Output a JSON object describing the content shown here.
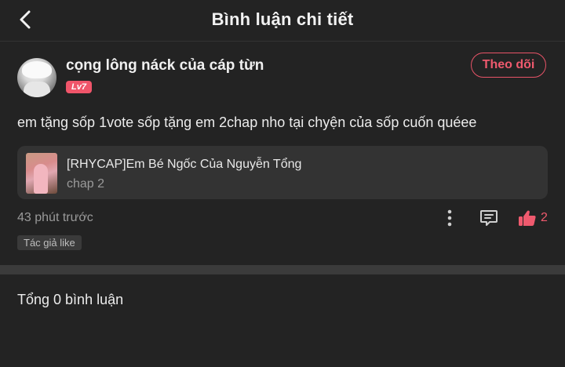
{
  "header": {
    "title": "Bình luận chi tiết",
    "back_icon": "chevron-left-icon"
  },
  "comment": {
    "username": "cọng lông náck của cáp từn",
    "level": "Lv7",
    "follow_label": "Theo dõi",
    "text": "em tặng sốp 1vote sốp tặng em 2chap nho tại chyện của sốp cuốn quéee",
    "story": {
      "title": "[RHYCAP]Em Bé Ngốc Của Nguyễn Tổng",
      "chapter": "chap 2"
    },
    "time": "43 phút trước",
    "like_count": "2",
    "author_like": "Tác giả like"
  },
  "footer": {
    "total": "Tổng 0 bình luận"
  },
  "colors": {
    "accent": "#ef5a6e",
    "background": "#232323",
    "card": "#333333"
  }
}
